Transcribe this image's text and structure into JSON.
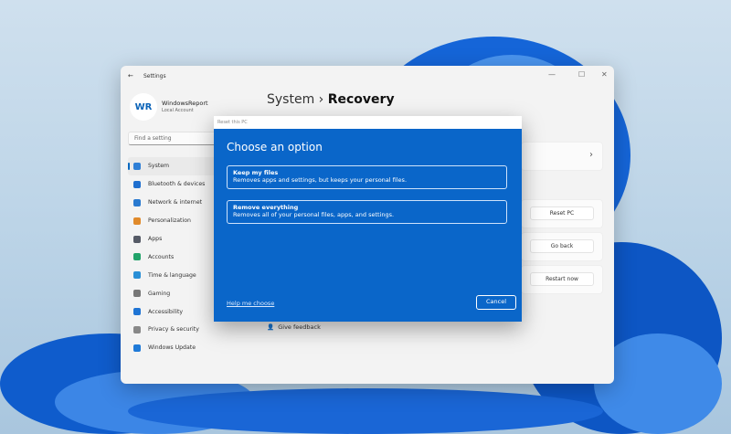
{
  "window": {
    "title": "Settings",
    "back": "←",
    "minimize": "—",
    "maximize": "☐",
    "close": "✕"
  },
  "user": {
    "initials": "WR",
    "name": "WindowsReport",
    "type": "Local Account"
  },
  "search": {
    "placeholder": "Find a setting"
  },
  "nav": [
    {
      "label": "System",
      "color": "#2f7fd6"
    },
    {
      "label": "Bluetooth & devices",
      "color": "#1f6fcf"
    },
    {
      "label": "Network & internet",
      "color": "#2a7ad0"
    },
    {
      "label": "Personalization",
      "color": "#e08a2b"
    },
    {
      "label": "Apps",
      "color": "#555a66"
    },
    {
      "label": "Accounts",
      "color": "#22a36a"
    },
    {
      "label": "Time & language",
      "color": "#2a8fd6"
    },
    {
      "label": "Gaming",
      "color": "#777"
    },
    {
      "label": "Accessibility",
      "color": "#1f74d4"
    },
    {
      "label": "Privacy & security",
      "color": "#888"
    },
    {
      "label": "Windows Update",
      "color": "#1f7ad8"
    }
  ],
  "breadcrumb": {
    "parent": "System",
    "sep": "›",
    "current": "Recovery"
  },
  "recovery": {
    "chevron": "›",
    "reset": "Reset PC",
    "goback": "Go back",
    "restart": "Restart now",
    "feedback": "Give feedback"
  },
  "dialog": {
    "title": "Reset this PC",
    "heading": "Choose an option",
    "options": [
      {
        "title": "Keep my files",
        "desc": "Removes apps and settings, but keeps your personal files."
      },
      {
        "title": "Remove everything",
        "desc": "Removes all of your personal files, apps, and settings."
      }
    ],
    "help": "Help me choose",
    "cancel": "Cancel"
  }
}
